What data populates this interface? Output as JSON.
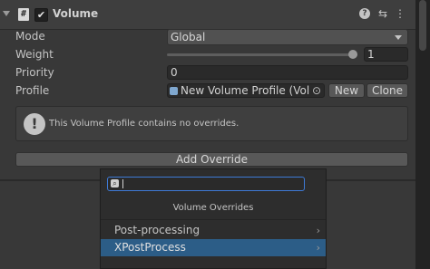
{
  "component": {
    "title": "Volume",
    "script_icon_glyph": "#",
    "enabled_glyph": "✔",
    "help_glyph": "?",
    "settings_glyph": "⇆",
    "menu_glyph": "⋮"
  },
  "fields": {
    "mode_label": "Mode",
    "mode_value": "Global",
    "weight_label": "Weight",
    "weight_value": "1",
    "weight_fraction": 1.0,
    "priority_label": "Priority",
    "priority_value": "0",
    "profile_label": "Profile",
    "profile_value": "New Volume Profile (Volu",
    "profile_picker_glyph": "⊙",
    "new_button": "New",
    "clone_button": "Clone"
  },
  "help_box": {
    "icon_glyph": "!",
    "text": "This Volume Profile contains no overrides."
  },
  "add_override_button": "Add Override",
  "popup": {
    "search_value": "",
    "search_icon_glyph": "⌕",
    "title": "Volume Overrides",
    "items": [
      {
        "label": "Post-processing",
        "arrow": "›"
      },
      {
        "label": "XPostProcess",
        "arrow": "›"
      }
    ],
    "selected_index": 1
  },
  "colors": {
    "selection": "#2c5d87",
    "search_focus": "#3e7ad6"
  }
}
